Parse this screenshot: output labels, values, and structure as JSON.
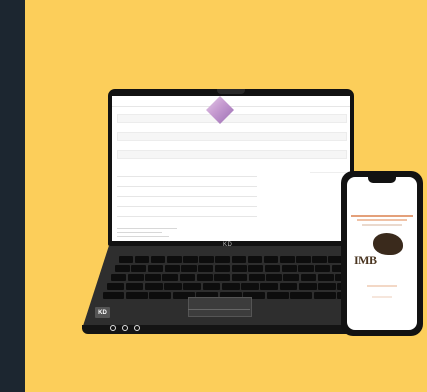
{
  "laptop": {
    "screen": {
      "title": "",
      "fields": [
        "",
        "",
        ""
      ],
      "table_headers": [
        "",
        "",
        ""
      ],
      "rows": [],
      "chart_legend": []
    },
    "lid_brand": "KD",
    "keyboard_badge": "KD"
  },
  "phone": {
    "logo_text": "IMB",
    "body_text": []
  },
  "colors": {
    "page_background": "#1c2630",
    "panel_background": "#fcce5a",
    "device_body": "#121212",
    "chart_accent": "#9a6cb3",
    "phone_text_accent": "#e4a07a"
  },
  "icons": [
    "laptop-device",
    "phone-device",
    "port-icon"
  ]
}
